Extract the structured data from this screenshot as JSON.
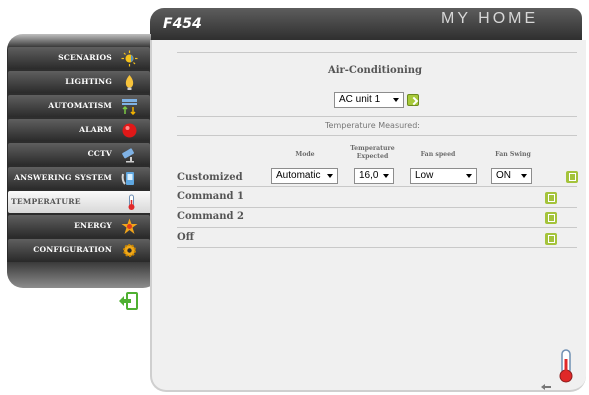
{
  "app": {
    "model": "F454",
    "brand": "MY HOME"
  },
  "sidebar": {
    "items": [
      {
        "label": "SCENARIOS",
        "icon": "sun-icon"
      },
      {
        "label": "LIGHTING",
        "icon": "bulb-icon"
      },
      {
        "label": "AUTOMATISM",
        "icon": "automation-arrows-icon"
      },
      {
        "label": "ALARM",
        "icon": "alarm-icon"
      },
      {
        "label": "CCTV",
        "icon": "camera-icon"
      },
      {
        "label": "ANSWERING SYSTEM",
        "icon": "phone-icon"
      },
      {
        "label": "TEMPERATURE CONTROL",
        "icon": "thermometer-icon",
        "active": true
      },
      {
        "label": "ENERGY MANAGEMENT",
        "icon": "energy-icon"
      },
      {
        "label": "CONFIGURATION",
        "icon": "gear-icon"
      }
    ]
  },
  "main": {
    "title": "Air-Conditioning",
    "unit_select": "AC unit 1",
    "section_title": "Temperature Measured:",
    "columns": {
      "mode": "Mode",
      "temperature_expected": "Temperature Expected",
      "fan_speed": "Fan speed",
      "fan_swing": "Fan Swing"
    },
    "customized": {
      "label": "Customized",
      "mode": "Automatic",
      "temperature": "16,0",
      "fan_speed": "Low",
      "fan_swing": "ON"
    },
    "commands": [
      {
        "label": "Command 1"
      },
      {
        "label": "Command 2"
      },
      {
        "label": "Off"
      }
    ]
  },
  "colors": {
    "accent_green": "#a4c33b",
    "sidebar_dark": "#2b2b2b",
    "panel_bg": "#f0f0f0"
  }
}
